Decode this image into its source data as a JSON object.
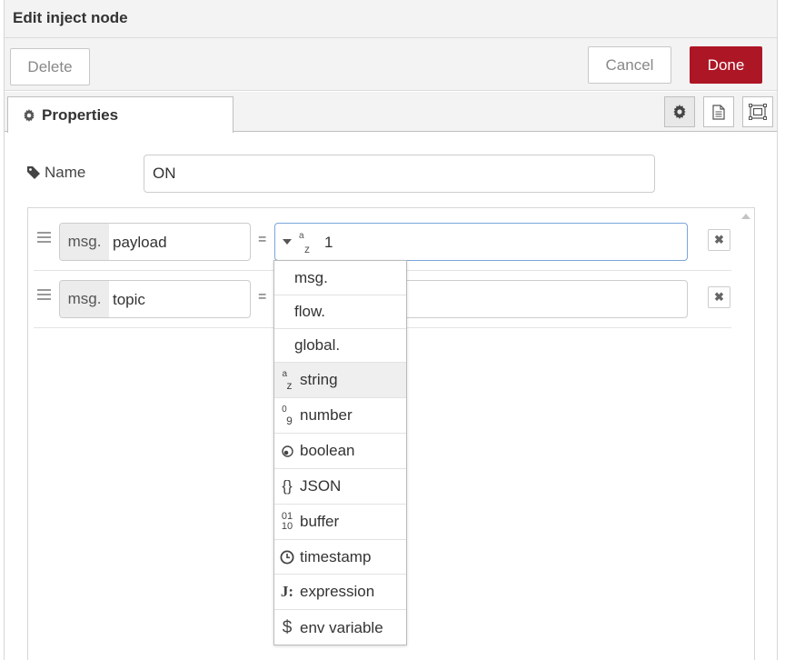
{
  "dialog": {
    "title": "Edit inject node",
    "delete_label": "Delete",
    "cancel_label": "Cancel",
    "done_label": "Done",
    "done_color": "#ad1625"
  },
  "tabs": {
    "properties_label": "Properties",
    "icons": [
      "gear-icon",
      "description-icon",
      "appearance-icon"
    ]
  },
  "name_field": {
    "label": "Name",
    "value": "ON"
  },
  "properties": [
    {
      "prefix": "msg.",
      "property": "payload",
      "equals": "=",
      "type_icon": "a z",
      "value": "1"
    },
    {
      "prefix": "msg.",
      "property": "topic",
      "equals": "=",
      "value": ""
    }
  ],
  "type_menu": {
    "items": [
      {
        "label": "msg.",
        "icon": ""
      },
      {
        "label": "flow.",
        "icon": ""
      },
      {
        "label": "global.",
        "icon": ""
      },
      {
        "label": "string",
        "icon": "a z",
        "selected": true
      },
      {
        "label": "number",
        "icon": "0 9"
      },
      {
        "label": "boolean",
        "icon": "toggle-icon"
      },
      {
        "label": "JSON",
        "icon": "{}"
      },
      {
        "label": "buffer",
        "icon": "01 10"
      },
      {
        "label": "timestamp",
        "icon": "clock-icon"
      },
      {
        "label": "expression",
        "icon": "J:"
      },
      {
        "label": "env variable",
        "icon": "$"
      }
    ]
  }
}
